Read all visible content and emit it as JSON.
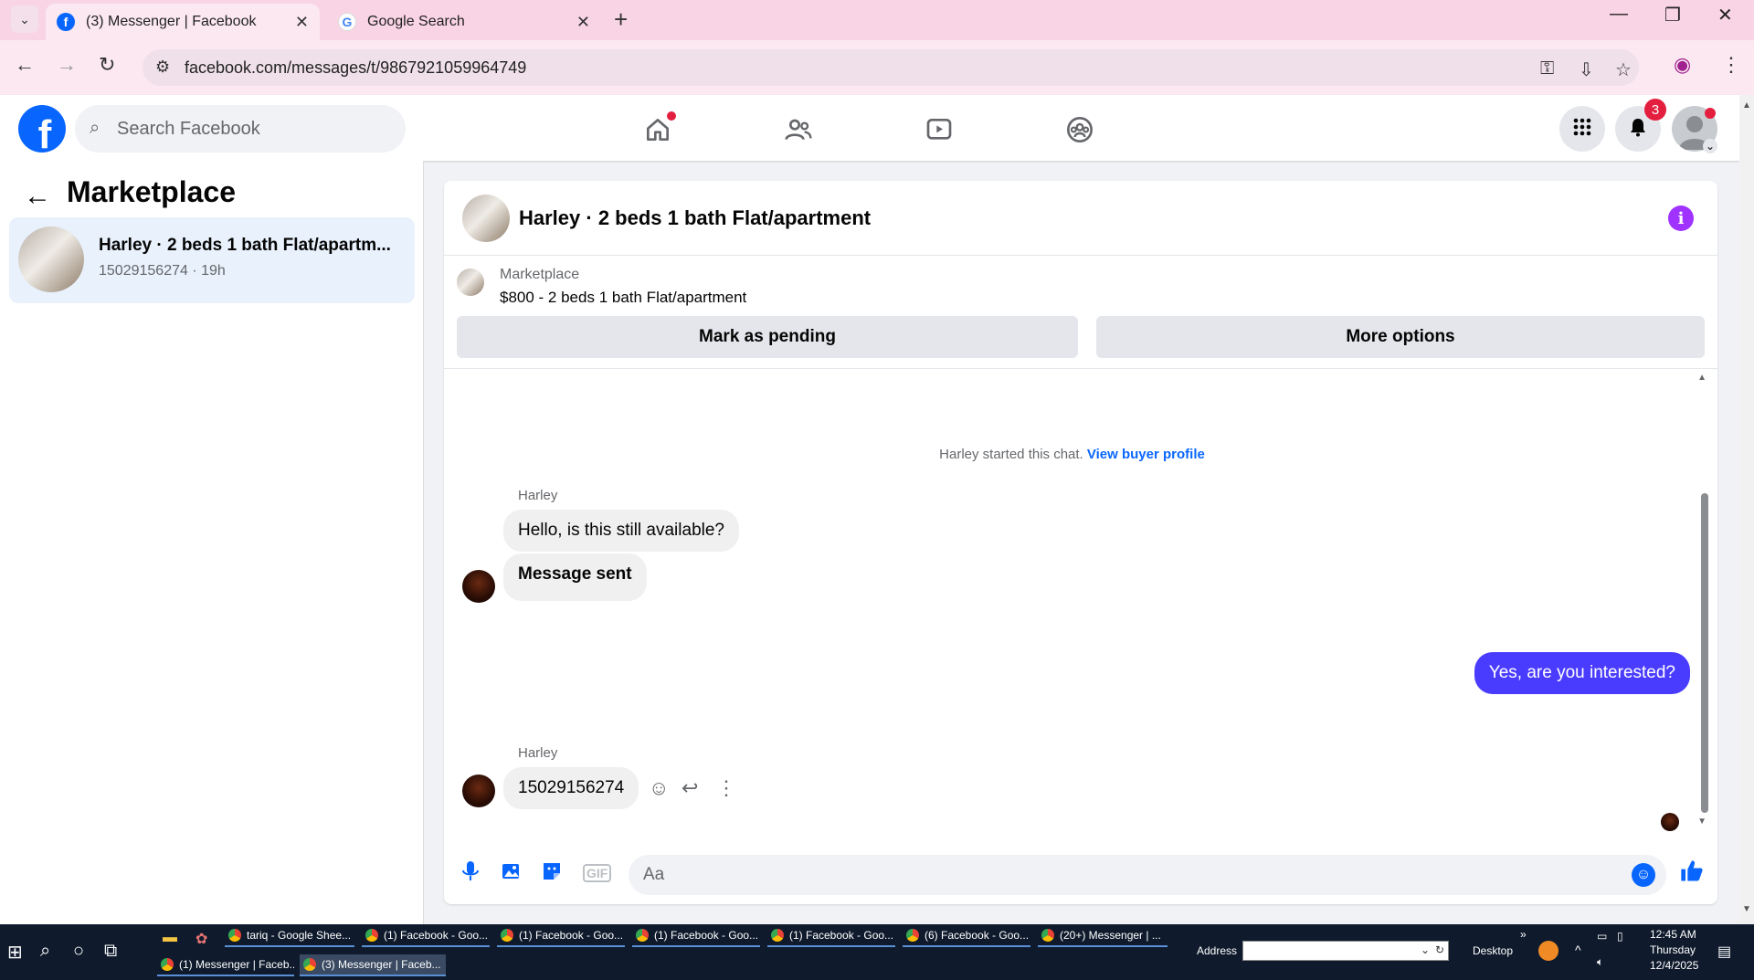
{
  "browser": {
    "tabs": [
      {
        "title": "(3) Messenger | Facebook",
        "active": true
      },
      {
        "title": "Google Search",
        "active": false
      }
    ],
    "url": "facebook.com/messages/t/9867921059964749"
  },
  "fb": {
    "search_placeholder": "Search Facebook",
    "notifications_count": "3"
  },
  "left": {
    "title": "Marketplace",
    "conversation": {
      "name": "Harley · 2 beds 1 bath Flat/apartm...",
      "sub": "15029156274 · 19h"
    }
  },
  "chat": {
    "title": "Harley · 2 beds 1 bath Flat/apartment",
    "listing_label": "Marketplace",
    "listing_price": "$800 - 2 beds 1 bath Flat/apartment",
    "btn_pending": "Mark as pending",
    "btn_more": "More options",
    "system_text": "Harley started this chat.",
    "system_link": "View buyer profile",
    "sender1": "Harley",
    "msg1": "Hello, is this still available?",
    "msg2": "Message sent",
    "msg_me": "Yes, are you interested?",
    "sender2": "Harley",
    "msg3": "15029156274",
    "composer_placeholder": "Aa"
  },
  "taskbar": {
    "items_row1": [
      "tariq - Google Shee...",
      "(1) Facebook - Goo...",
      "(1) Facebook - Goo...",
      "(1) Facebook - Goo...",
      "(1) Facebook - Goo...",
      "(6) Facebook - Goo...",
      "(20+) Messenger | ..."
    ],
    "items_row2": [
      "(1) Messenger | Faceb...",
      "(3) Messenger | Faceb..."
    ],
    "address_label": "Address",
    "desktop_label": "Desktop",
    "time": "12:45 AM",
    "day": "Thursday",
    "date": "12/4/2025"
  }
}
